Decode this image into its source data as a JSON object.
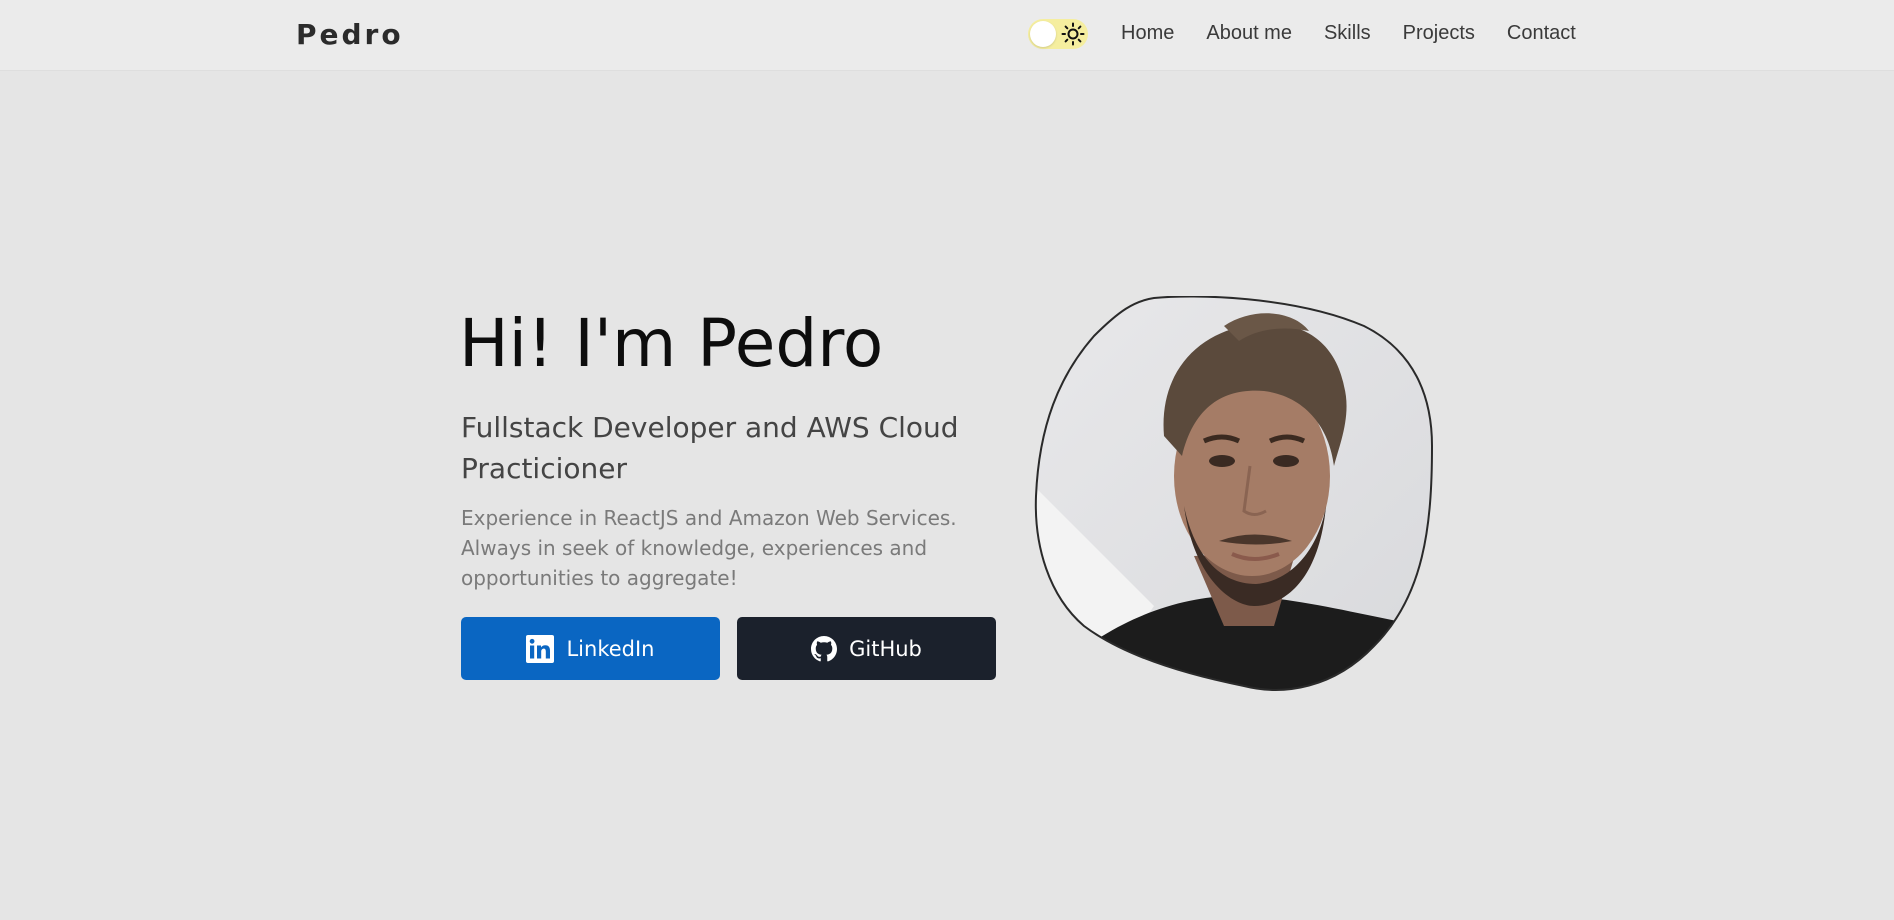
{
  "nav": {
    "brand": "Pedro",
    "theme_toggle_icon": "sun-icon",
    "links": [
      "Home",
      "About me",
      "Skills",
      "Projects",
      "Contact"
    ]
  },
  "hero": {
    "title": "Hi! I'm Pedro",
    "subtitle": "Fullstack Developer and AWS Cloud Practicioner",
    "description": "Experience in ReactJS and Amazon Web Services. Always in seek of knowledge, experiences and opportunities to aggregate!",
    "buttons": {
      "linkedin": {
        "label": "LinkedIn",
        "icon": "linkedin-icon",
        "color": "#0a66c2"
      },
      "github": {
        "label": "GitHub",
        "icon": "github-icon",
        "color": "#1b212c"
      }
    },
    "avatar": {
      "icon": "profile-photo"
    }
  },
  "colors": {
    "background": "#e5e5e5",
    "navbar": "#ebebeb",
    "toggle_track": "#f5ee9f"
  }
}
